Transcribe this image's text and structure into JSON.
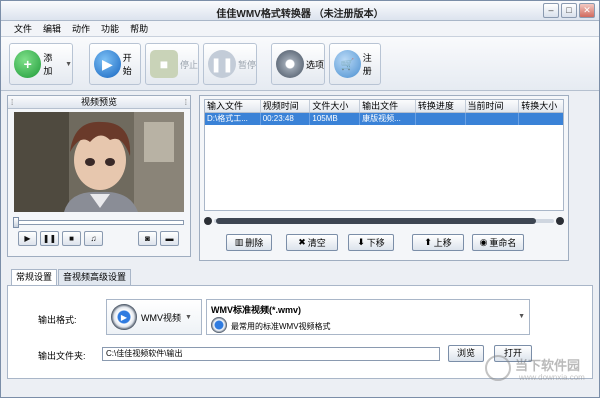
{
  "window": {
    "title": "佳佳WMV格式转换器 （未注册版本）",
    "min": "–",
    "max": "□",
    "close": "✕"
  },
  "menu": [
    "文件",
    "编辑",
    "动作",
    "功能",
    "帮助"
  ],
  "toolbar": {
    "add": "添加",
    "start": "开始",
    "stop": "停止",
    "pause": "暂停",
    "options": "选项",
    "register": "注册"
  },
  "preview": {
    "title": "视频预览",
    "grip": "⁞"
  },
  "files": {
    "headers": [
      "输入文件",
      "视频时间",
      "文件大小",
      "输出文件",
      "转换进度",
      "当前时间",
      "转换大小"
    ],
    "rows": [
      [
        "D:\\格式工...",
        "00:23:48",
        "105MB",
        "康版视频...",
        "",
        "",
        ""
      ]
    ]
  },
  "actions": {
    "delete": "删除",
    "clear": "清空",
    "down": "下移",
    "up": "上移",
    "rename": "重命名"
  },
  "tabs": [
    "常规设置",
    "音视频高级设置"
  ],
  "settings": {
    "format_label": "输出格式:",
    "format_value": "WMV视频",
    "format_title": "WMV标准视频(*.wmv)",
    "format_desc": "最常用的标准WMV视频格式",
    "folder_label": "输出文件夹:",
    "folder_value": "C:\\佳佳视频软件\\输出",
    "browse": "浏览",
    "open": "打开"
  },
  "watermark": {
    "name": "当下软件园",
    "url": "www.downxia.com"
  },
  "colors": {
    "accent": "#3a82d7",
    "add_icon": "#2db34a",
    "start_icon": "#1f7fd6"
  }
}
